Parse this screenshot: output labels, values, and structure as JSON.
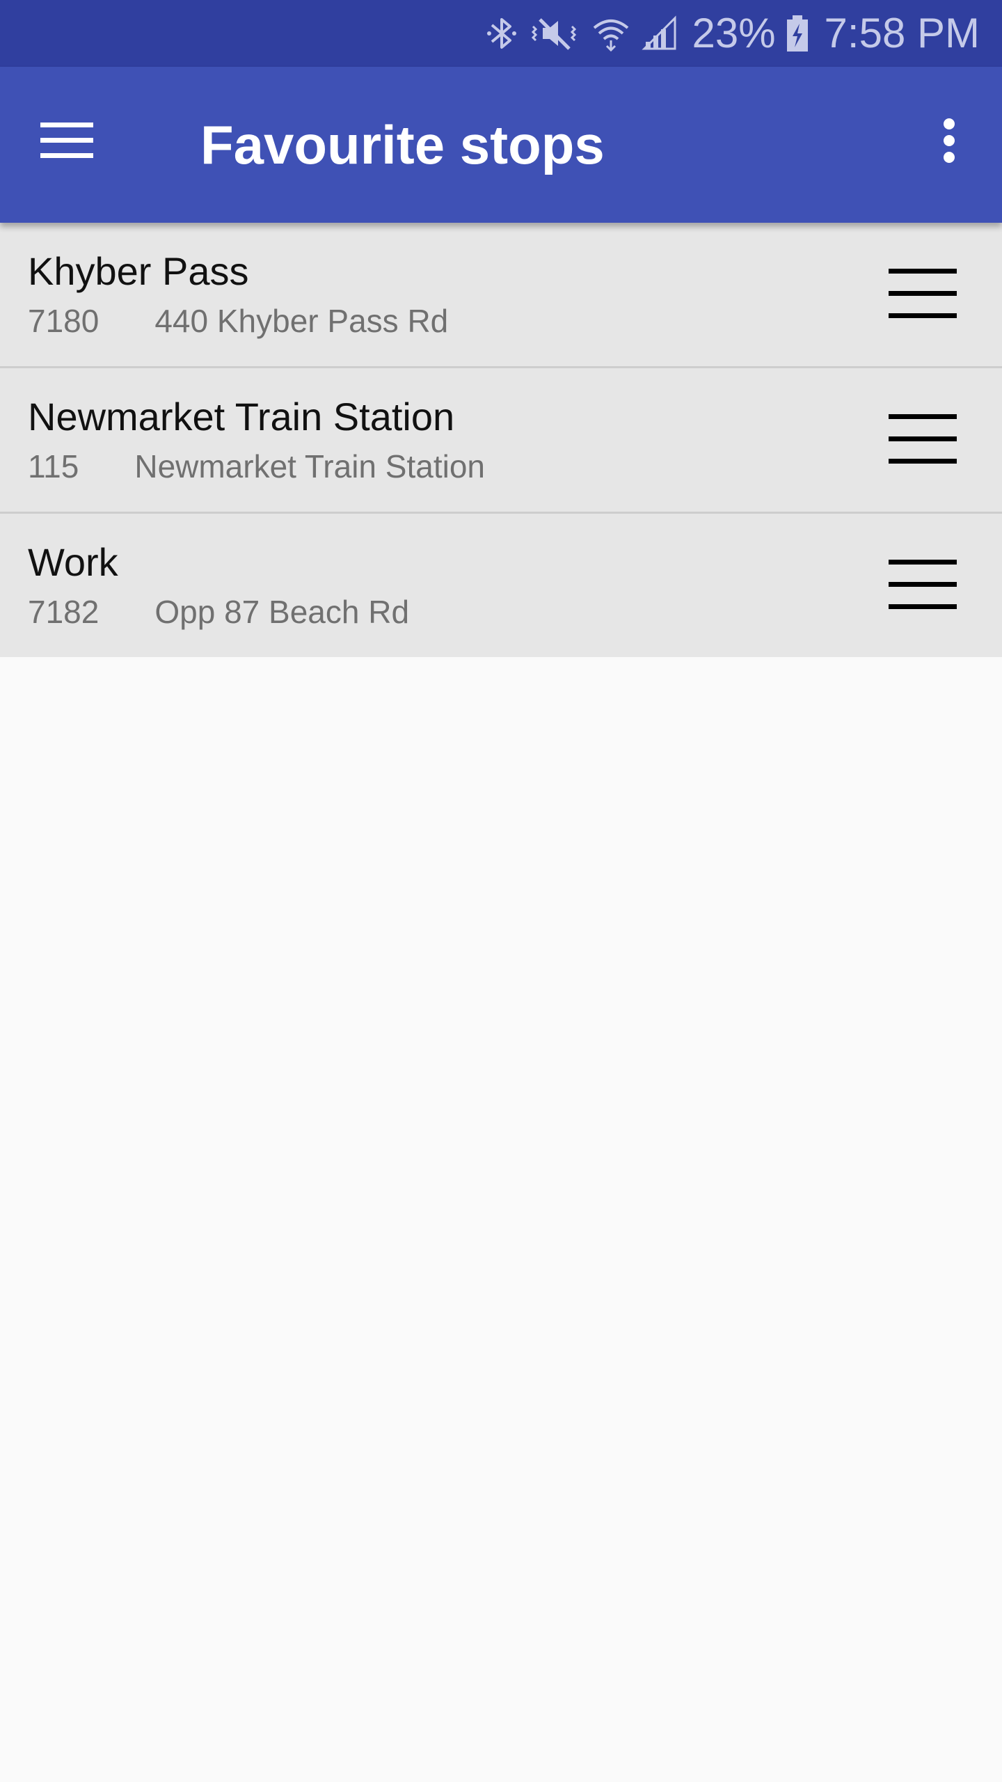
{
  "status_bar": {
    "icons": [
      "bluetooth-icon",
      "vibrate-mute-icon",
      "wifi-icon",
      "signal-icon"
    ],
    "battery_percent": "23%",
    "battery_icon": "battery-charging-icon",
    "time": "7:58 PM",
    "color": "#303f9f"
  },
  "app_bar": {
    "title": "Favourite stops",
    "menu_icon": "hamburger-menu-icon",
    "overflow_icon": "overflow-menu-icon",
    "color": "#3f51b5"
  },
  "stops": [
    {
      "name": "Khyber Pass",
      "code": "7180",
      "address": "440 Khyber Pass Rd"
    },
    {
      "name": "Newmarket Train Station",
      "code": "115",
      "address": "Newmarket Train Station"
    },
    {
      "name": "Work",
      "code": "7182",
      "address": "Opp 87 Beach Rd"
    }
  ],
  "colors": {
    "row_background": "#e6e6e6",
    "page_background": "#fafafa",
    "primary_text": "#111111",
    "secondary_text": "#707070"
  }
}
